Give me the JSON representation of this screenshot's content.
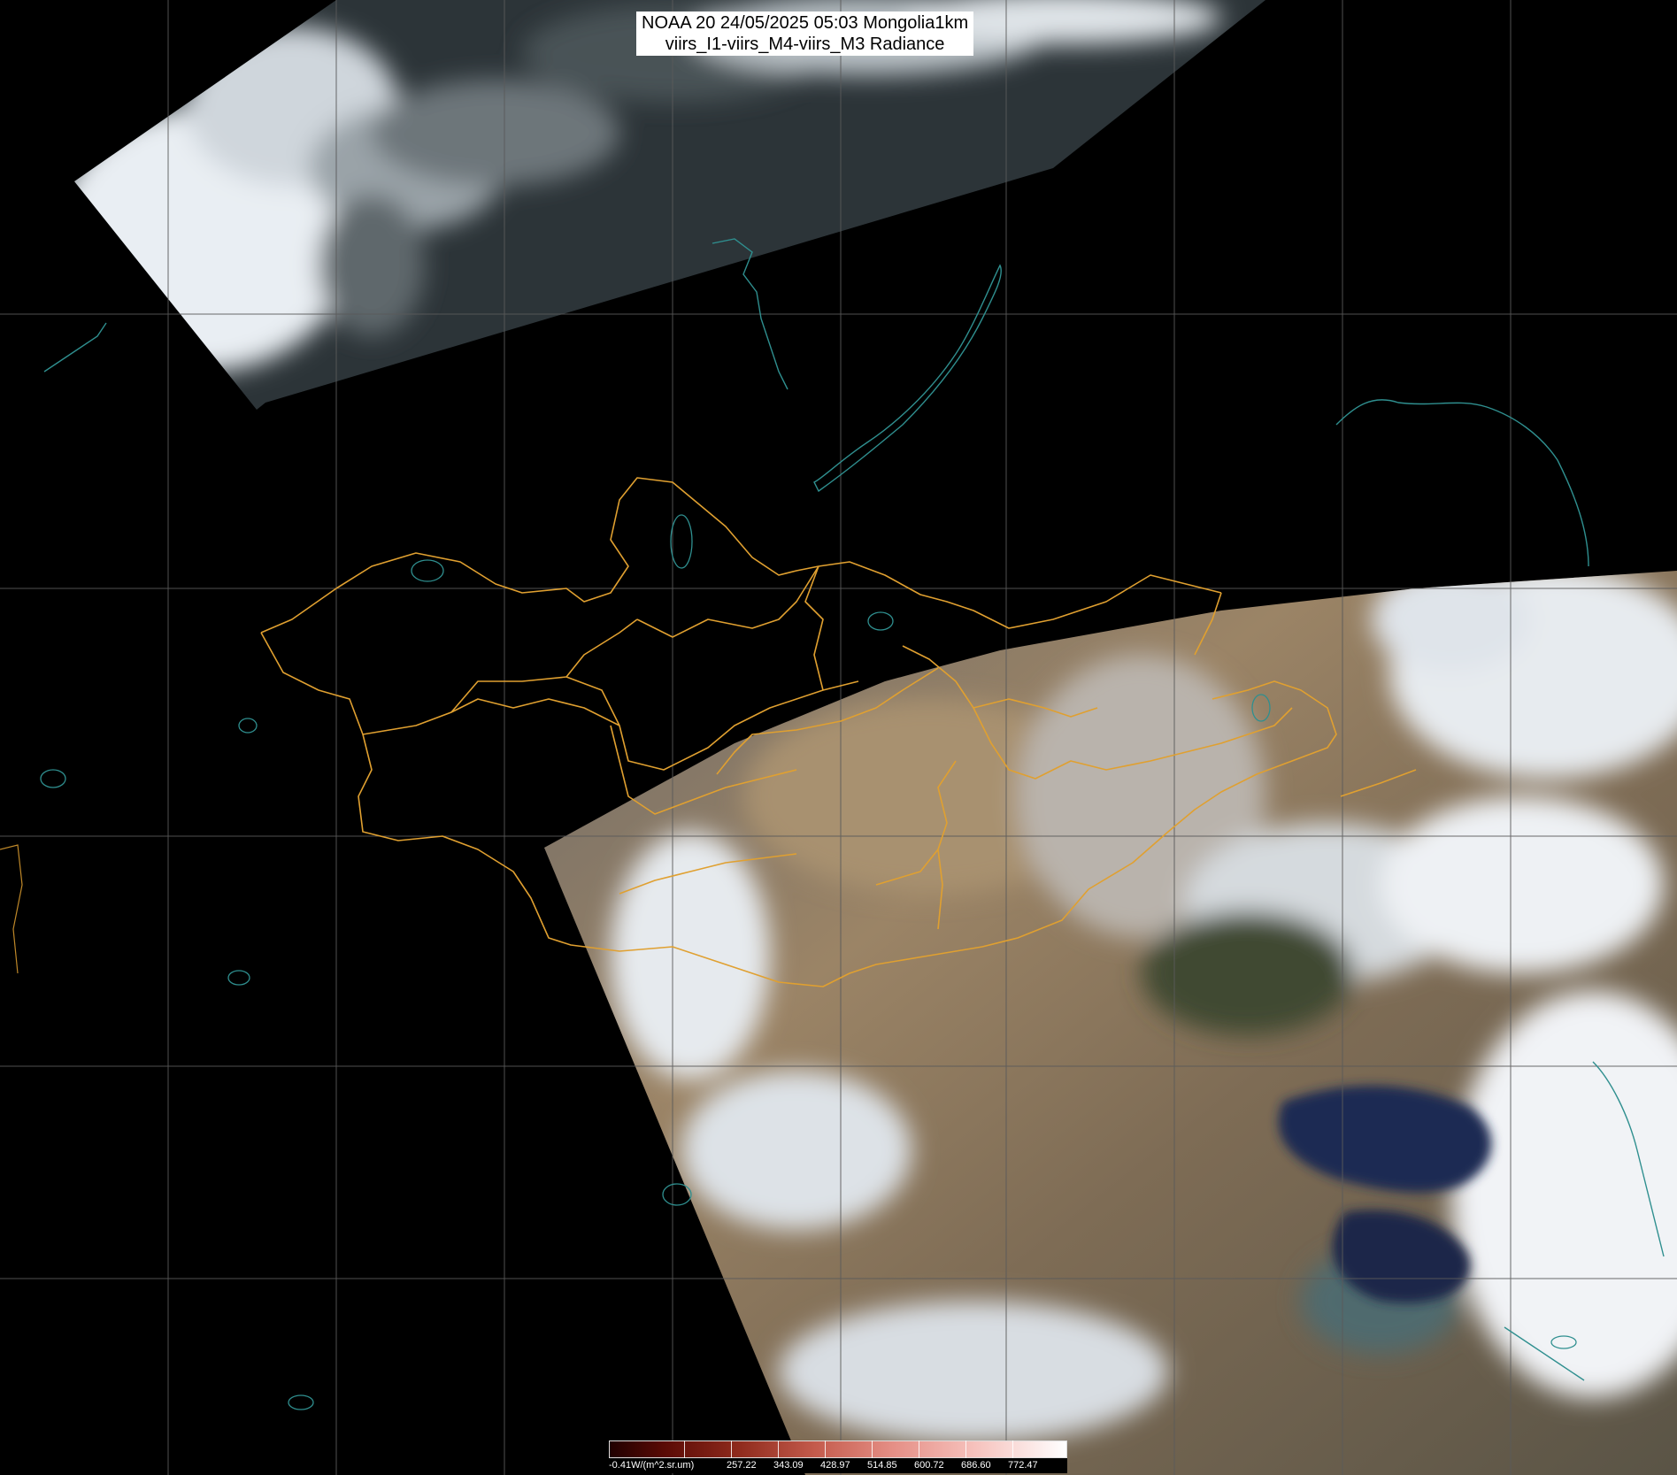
{
  "title": {
    "line1": "NOAA 20 24/05/2025 05:03 Mongolia1km",
    "line2": "viirs_I1-viirs_M4-viirs_M3 Radiance"
  },
  "colorbar": {
    "unit_label": "-0.41W/(m^2.sr.um)",
    "ticks": [
      "257.22",
      "343.09",
      "428.97",
      "514.85",
      "600.72",
      "686.60",
      "772.47"
    ]
  },
  "colors": {
    "background": "#000000",
    "grid": "#5a5a5a",
    "border_lines": "#e0a030",
    "coast_lines": "#2f8f8f",
    "cloud": "#eef1f4",
    "land": "#8c7b62",
    "sea": "#1d2b52"
  }
}
